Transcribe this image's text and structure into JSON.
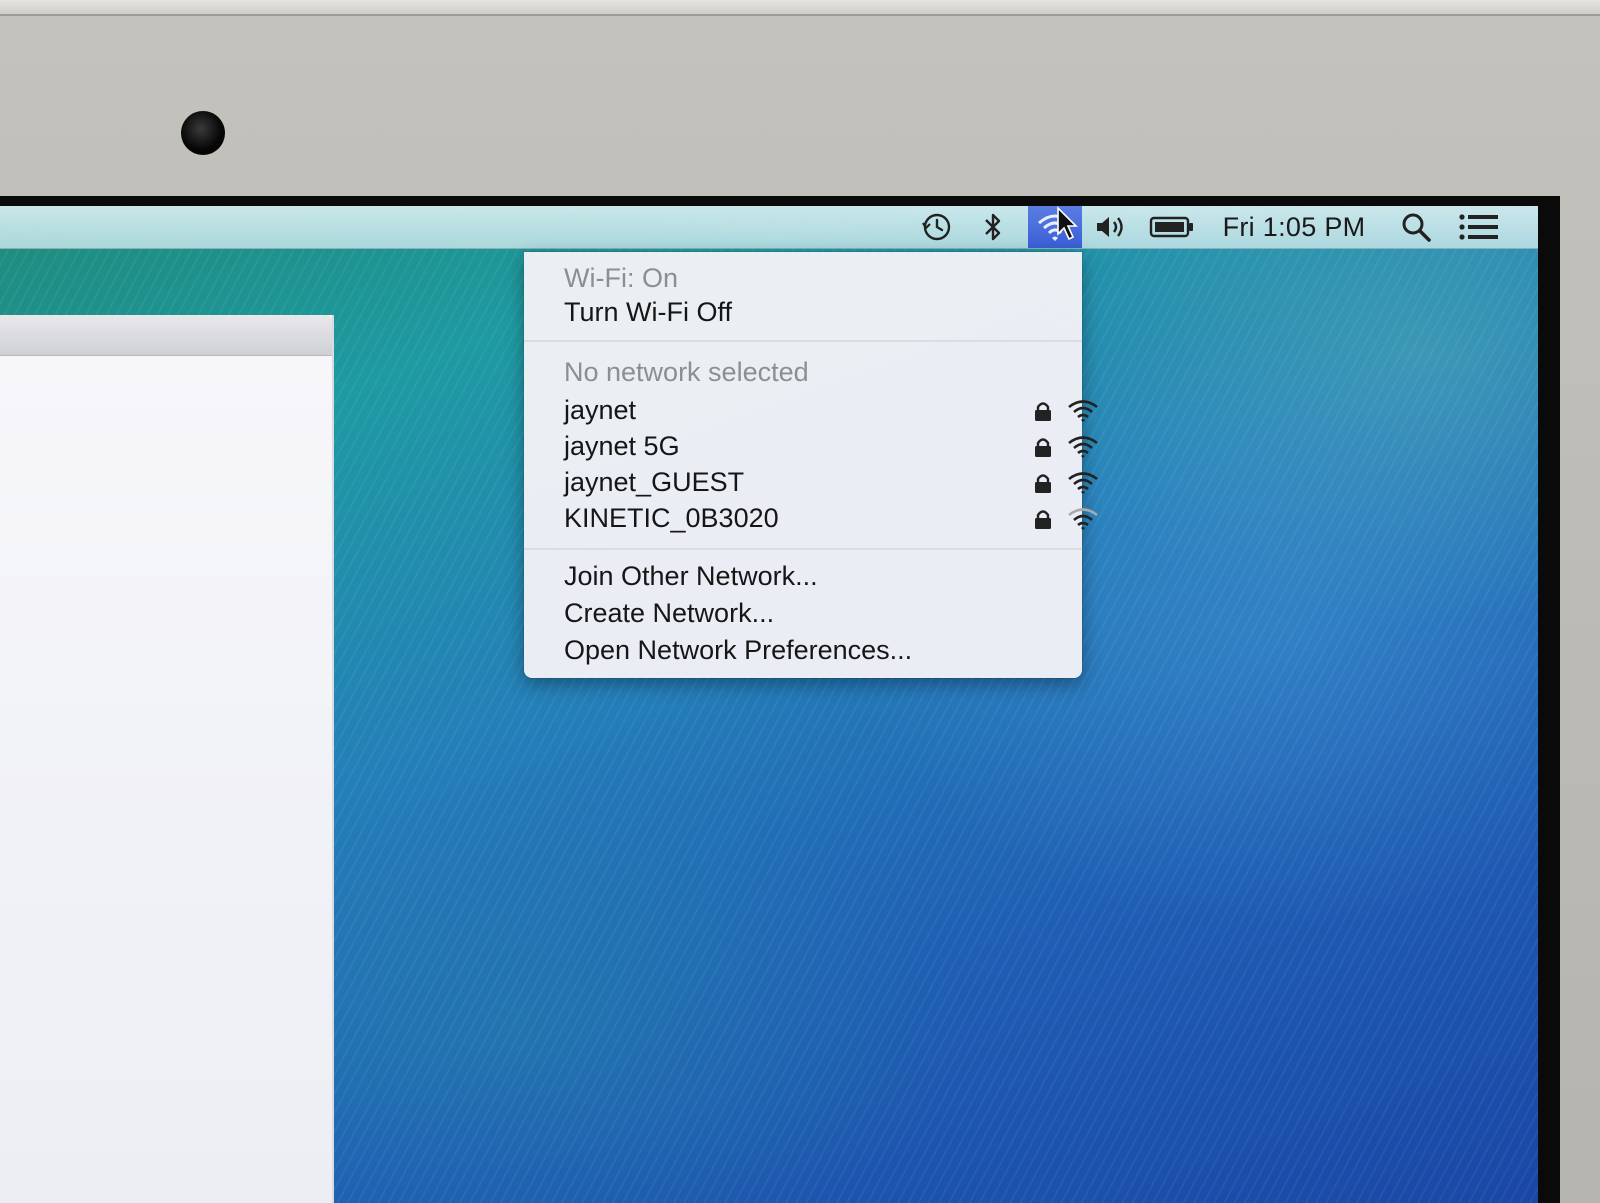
{
  "menubar": {
    "time_machine_icon": "time-machine-icon",
    "bluetooth_icon": "bluetooth-icon",
    "wifi_icon": "wifi-icon",
    "volume_icon": "volume-icon",
    "battery_icon": "battery-icon",
    "clock": "Fri 1:05 PM",
    "spotlight_icon": "search-icon",
    "notification_icon": "list-icon",
    "active_color": "#3a5fd6"
  },
  "wifi_menu": {
    "status": "Wi-Fi: On",
    "toggle": "Turn Wi-Fi Off",
    "no_network": "No network selected",
    "networks": [
      {
        "name": "jaynet",
        "locked": true,
        "signal": "full"
      },
      {
        "name": "jaynet 5G",
        "locked": true,
        "signal": "full"
      },
      {
        "name": "jaynet_GUEST",
        "locked": true,
        "signal": "full"
      },
      {
        "name": "KINETIC_0B3020",
        "locked": true,
        "signal": "medium"
      }
    ],
    "join_other": "Join Other Network...",
    "create": "Create Network...",
    "preferences": "Open Network Preferences..."
  }
}
